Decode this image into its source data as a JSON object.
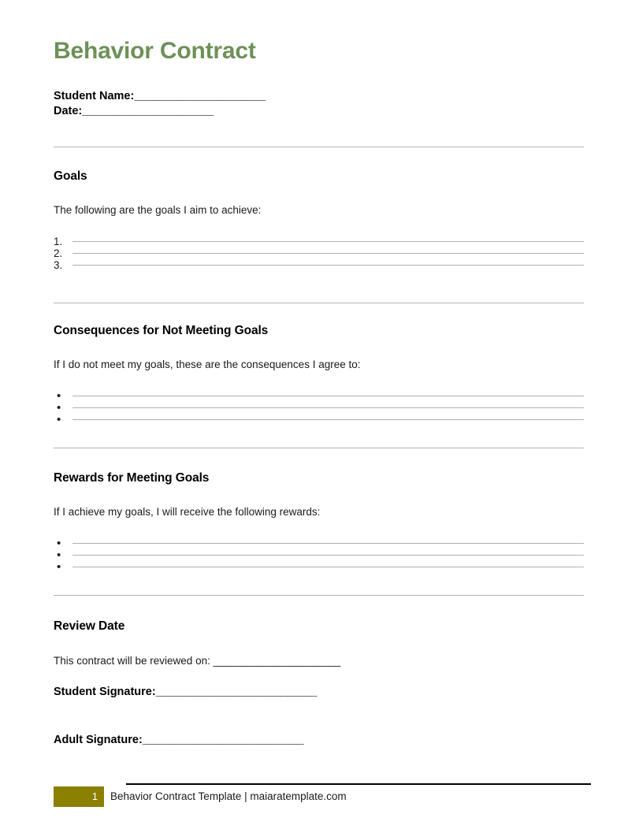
{
  "document": {
    "title": "Behavior Contract",
    "title_color": "#6d9157"
  },
  "identity": {
    "student_name_label": "Student Name:",
    "student_name_rule": "______________________",
    "date_label": "Date:",
    "date_rule": "______________________"
  },
  "sections": [
    {
      "heading": "Goals",
      "intro": "The following are the goals I aim to achieve:",
      "list_style": "numbered",
      "items": [
        "1.",
        "2.",
        "3."
      ]
    },
    {
      "heading": "Consequences for Not Meeting Goals",
      "intro": "If I do not meet my goals, these are the consequences I agree to:",
      "list_style": "bullet",
      "items": [
        "•",
        "•",
        "•"
      ]
    },
    {
      "heading": "Rewards for Meeting Goals",
      "intro": "If I achieve my goals, I will receive the following rewards:",
      "list_style": "bullet",
      "items": [
        "•",
        "•",
        "•"
      ]
    }
  ],
  "review": {
    "heading": "Review Date",
    "review_text": "This contract will be reviewed on: ",
    "review_rule": "_______________________",
    "student_signature_label": "Student Signature:",
    "student_signature_rule": "___________________________",
    "adult_signature_label": "Adult Signature:",
    "adult_signature_rule": "___________________________"
  },
  "footer": {
    "page_number": "1",
    "text": "Behavior Contract Template | maiaratemplate.com",
    "badge_color": "#8b8000"
  }
}
